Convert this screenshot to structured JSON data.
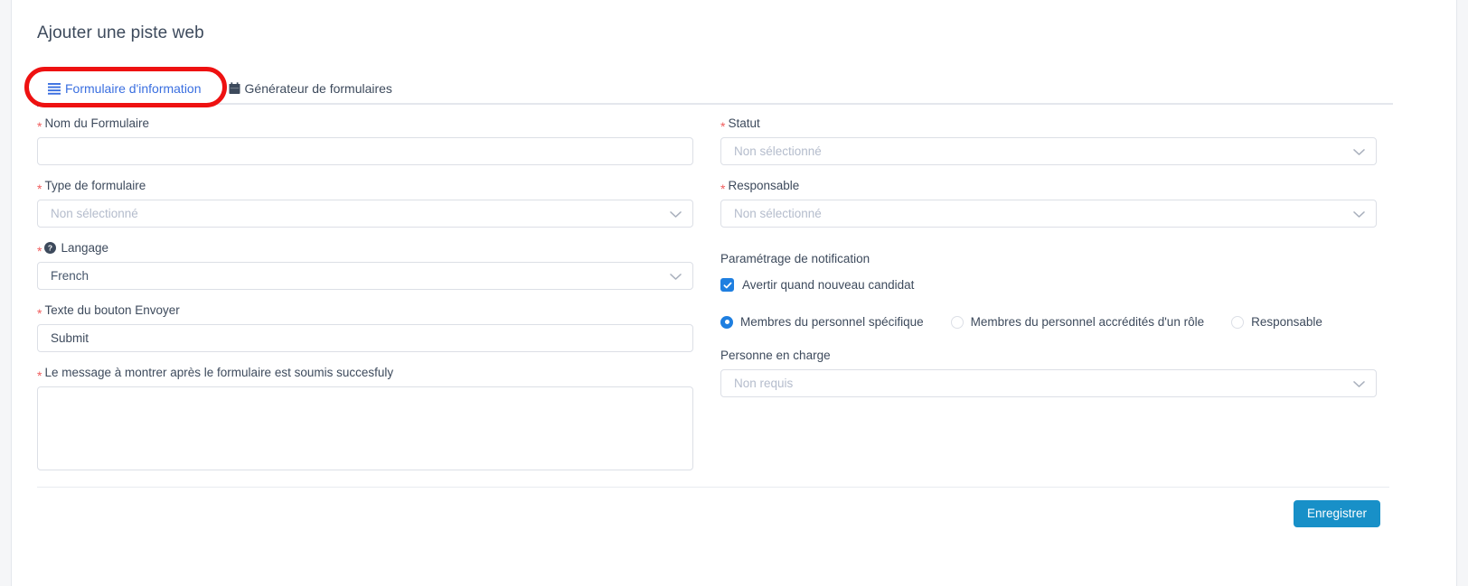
{
  "page": {
    "title": "Ajouter une piste web"
  },
  "tabs": [
    {
      "label": "Formulaire d'information",
      "icon": "list-bars-icon",
      "active": true
    },
    {
      "label": "Générateur de formulaires",
      "icon": "calendar-icon",
      "active": false
    }
  ],
  "left_column": {
    "form_name": {
      "label": "Nom du Formulaire",
      "required": "*",
      "value": "",
      "placeholder": ""
    },
    "form_type": {
      "label": "Type de formulaire",
      "required": "*",
      "value": "",
      "placeholder": "Non sélectionné"
    },
    "language": {
      "label": "Langage",
      "required": "*",
      "help_icon": "question-circle-icon",
      "value": "French"
    },
    "submit_button_text": {
      "label": "Texte du bouton Envoyer",
      "required": "*",
      "value": "Submit"
    },
    "success_message": {
      "label": "Le message à montrer après le formulaire est soumis succesfuly",
      "required": "*",
      "value": "",
      "placeholder": ""
    }
  },
  "right_column": {
    "status": {
      "label": "Statut",
      "required": "*",
      "value": "",
      "placeholder": "Non sélectionné"
    },
    "owner": {
      "label": "Responsable",
      "required": "*",
      "value": "",
      "placeholder": "Non sélectionné"
    },
    "notification": {
      "heading": "Paramétrage de notification",
      "checkbox": {
        "label": "Avertir quand nouveau candidat",
        "checked": true
      },
      "radios": [
        {
          "label": "Membres du personnel spécifique",
          "selected": true
        },
        {
          "label": "Membres du personnel accrédités d'un rôle",
          "selected": false
        },
        {
          "label": "Responsable",
          "selected": false
        }
      ],
      "person_in_charge": {
        "label": "Personne en charge",
        "value": "",
        "placeholder": "Non requis"
      }
    }
  },
  "footer": {
    "save_label": "Enregistrer"
  },
  "colors": {
    "accent_blue": "#3a6fe0",
    "save_button": "#1890c8",
    "required_red": "#f05d5d",
    "annotation_red": "#ee1111",
    "checkbox_blue": "#1f7fe0",
    "text": "#3d4a5c",
    "placeholder": "#b4bccc",
    "border": "#dcdfe6"
  }
}
